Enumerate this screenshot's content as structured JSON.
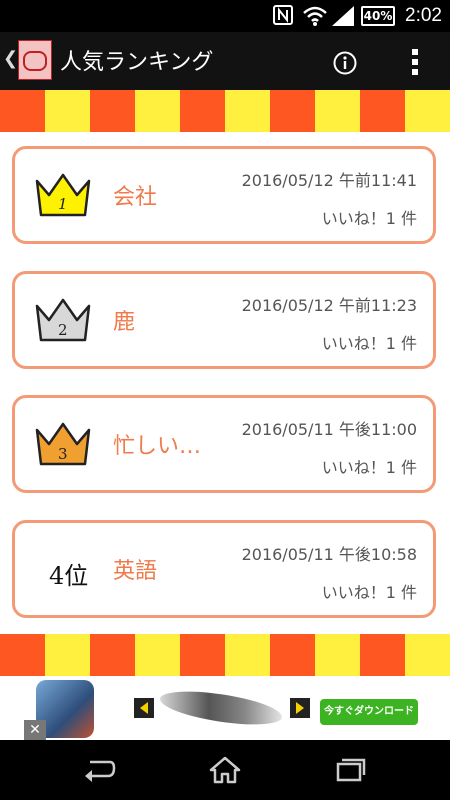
{
  "status_bar": {
    "time": "2:02",
    "battery": "40%",
    "icons": [
      "nfc-icon",
      "wifi-icon",
      "cell-signal-icon",
      "battery-icon"
    ]
  },
  "app_bar": {
    "title": "人気ランキング",
    "back_icon": "chevron-left-icon",
    "info_icon": "info-icon",
    "menu_icon": "more-vert-icon"
  },
  "ranking": [
    {
      "rank": "1",
      "word": "会社",
      "date": "2016/05/12 午前11:41",
      "likes": "いいね！1 件",
      "crown_color": "#fff200"
    },
    {
      "rank": "2",
      "word": "鹿",
      "date": "2016/05/12 午前11:23",
      "likes": "いいね！1 件",
      "crown_color": "#d8d8d8"
    },
    {
      "rank": "3",
      "word": "忙しい…",
      "date": "2016/05/11 午後11:00",
      "likes": "いいね！1 件",
      "crown_color": "#f0a030"
    },
    {
      "rank": "4位",
      "word": "英語",
      "date": "2016/05/11 午後10:58",
      "likes": "いいね！1 件",
      "crown_color": ""
    }
  ],
  "ad": {
    "download_label": "今すぐダウンロード",
    "close_label": "✕"
  },
  "nav_bar": {
    "icons": [
      "back-icon",
      "home-icon",
      "recents-icon"
    ]
  },
  "colors": {
    "accent": "#f07a4a",
    "card_border": "#f59a76",
    "stripe_orange": "#ff5722",
    "stripe_yellow": "#fff040"
  }
}
